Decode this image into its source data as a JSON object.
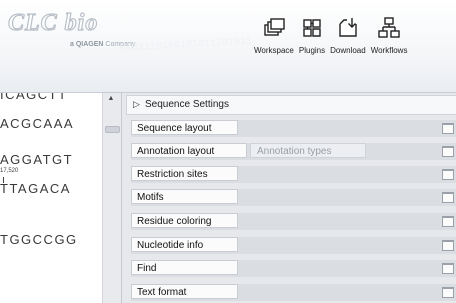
{
  "brand": {
    "logo_text": "CLC bio",
    "sub_brand": "a QIAGEN",
    "sub_suffix": "Company",
    "binary_text": "0101110100101011101011"
  },
  "toolbar": [
    {
      "label": "Workspace",
      "icon": "workspace-icon"
    },
    {
      "label": "Plugins",
      "icon": "plugins-icon"
    },
    {
      "label": "Download",
      "icon": "download-icon"
    },
    {
      "label": "Workflows",
      "icon": "workflows-icon"
    }
  ],
  "sequence_view": {
    "lines": [
      {
        "text": "ICAGCTT"
      },
      {
        "text": "ACGCAAA"
      },
      {
        "text": "AGGATGT"
      },
      {
        "text": "TTAGACA"
      },
      {
        "text": "TGGCCGG"
      }
    ],
    "coordinate": "17,520"
  },
  "settings_panel": {
    "title": "Sequence Settings",
    "rows": [
      {
        "label": "Sequence layout"
      },
      {
        "label": "Annotation layout",
        "extra": "Annotation types"
      },
      {
        "label": "Restriction sites"
      },
      {
        "label": "Motifs"
      },
      {
        "label": "Residue coloring"
      },
      {
        "label": "Nucleotide info"
      },
      {
        "label": "Find"
      },
      {
        "label": "Text format"
      }
    ]
  }
}
